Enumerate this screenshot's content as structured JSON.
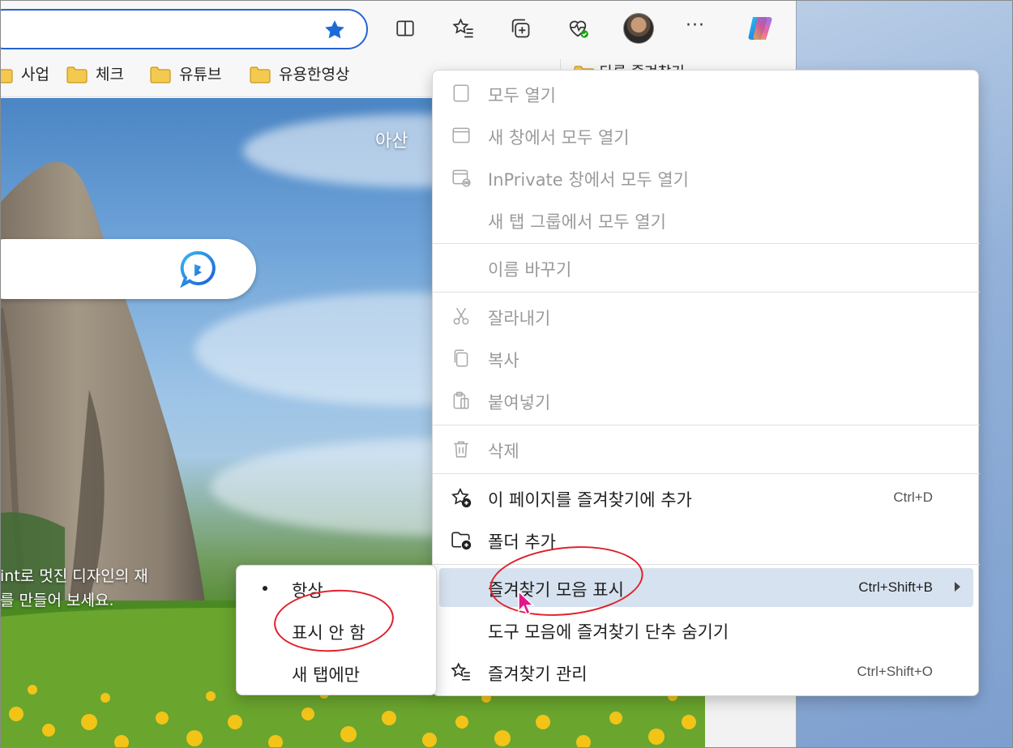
{
  "toolbar": {
    "icons": [
      "favorite-star-icon",
      "split-screen-icon",
      "favorites-icon",
      "collections-icon",
      "browser-essentials-icon",
      "profile-avatar",
      "more-icon",
      "copilot-icon"
    ],
    "more_label": "···"
  },
  "favorites_bar": {
    "items": [
      {
        "label": "사업"
      },
      {
        "label": "체크"
      },
      {
        "label": "유튜브"
      },
      {
        "label": "유용한영상"
      }
    ],
    "partially_hidden_label": "다른 즐겨찾기"
  },
  "page": {
    "location": "아산",
    "promo_lines": [
      "int로 멋진 디자인의 재",
      "를 만들어 보세요."
    ]
  },
  "context_menu": {
    "items": [
      {
        "label": "모두 열기",
        "icon": "page-icon",
        "enabled": false
      },
      {
        "label": "새 창에서 모두 열기",
        "icon": "window-icon",
        "enabled": false
      },
      {
        "label": "InPrivate 창에서 모두 열기",
        "icon": "inprivate-window-icon",
        "enabled": false
      },
      {
        "label": "새 탭 그룹에서 모두 열기",
        "icon": "",
        "enabled": false
      },
      {
        "label": "이름 바꾸기",
        "icon": "",
        "enabled": false
      },
      {
        "label": "잘라내기",
        "icon": "scissors-icon",
        "enabled": false
      },
      {
        "label": "복사",
        "icon": "copy-icon",
        "enabled": false
      },
      {
        "label": "붙여넣기",
        "icon": "paste-icon",
        "enabled": false
      },
      {
        "label": "삭제",
        "icon": "trash-icon",
        "enabled": false
      },
      {
        "label": "이 페이지를 즐겨찾기에 추가",
        "icon": "add-favorite-icon",
        "shortcut": "Ctrl+D",
        "enabled": true
      },
      {
        "label": "폴더 추가",
        "icon": "add-folder-icon",
        "enabled": true
      },
      {
        "label": "즐겨찾기 모음 표시",
        "icon": "",
        "shortcut": "Ctrl+Shift+B",
        "enabled": true,
        "has_submenu": true
      },
      {
        "label": "도구 모음에 즐겨찾기 단추 숨기기",
        "icon": "",
        "enabled": true
      },
      {
        "label": "즐겨찾기 관리",
        "icon": "manage-favorites-icon",
        "shortcut": "Ctrl+Shift+O",
        "enabled": true
      }
    ]
  },
  "submenu": {
    "items": [
      {
        "label": "항상",
        "selected": true
      },
      {
        "label": "표시 안 함",
        "selected": false
      },
      {
        "label": "새 탭에만",
        "selected": false
      }
    ]
  },
  "colors": {
    "accent": "#2563d6",
    "highlight": "#d6e2ef",
    "annotation": "#e0202a",
    "disabled_text": "#9a9a9a"
  }
}
